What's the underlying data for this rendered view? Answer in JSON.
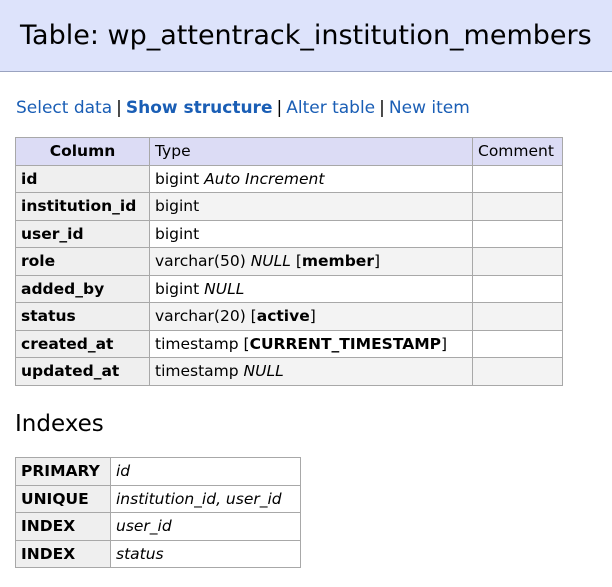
{
  "page_title": "Table: wp_attentrack_institution_members",
  "nav": {
    "select_data": "Select data",
    "show_structure": "Show structure",
    "alter_table": "Alter table",
    "new_item": "New item",
    "separator": "|"
  },
  "structure": {
    "headers": {
      "column": "Column",
      "type": "Type",
      "comment": "Comment"
    },
    "rows": [
      {
        "column": "id",
        "type": "bigint",
        "extra": "Auto Increment",
        "default": "",
        "comment": ""
      },
      {
        "column": "institution_id",
        "type": "bigint",
        "extra": "",
        "default": "",
        "comment": ""
      },
      {
        "column": "user_id",
        "type": "bigint",
        "extra": "",
        "default": "",
        "comment": ""
      },
      {
        "column": "role",
        "type": "varchar(50)",
        "extra": "NULL",
        "default": "member",
        "comment": ""
      },
      {
        "column": "added_by",
        "type": "bigint",
        "extra": "NULL",
        "default": "",
        "comment": ""
      },
      {
        "column": "status",
        "type": "varchar(20)",
        "extra": "",
        "default": "active",
        "comment": ""
      },
      {
        "column": "created_at",
        "type": "timestamp",
        "extra": "",
        "default": "CURRENT_TIMESTAMP",
        "comment": ""
      },
      {
        "column": "updated_at",
        "type": "timestamp",
        "extra": "NULL",
        "default": "",
        "comment": ""
      }
    ]
  },
  "indexes": {
    "heading": "Indexes",
    "rows": [
      {
        "kind": "PRIMARY",
        "columns": "id"
      },
      {
        "kind": "UNIQUE",
        "columns": "institution_id, user_id"
      },
      {
        "kind": "INDEX",
        "columns": "user_id"
      },
      {
        "kind": "INDEX",
        "columns": "status"
      }
    ]
  },
  "colors": {
    "link": "#1a5eb5",
    "title_bg": "#dde3fb",
    "header_bg": "#dcdcf5"
  }
}
